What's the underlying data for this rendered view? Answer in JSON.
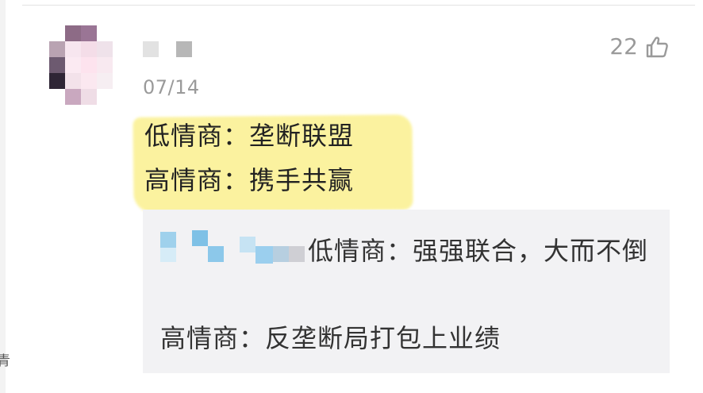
{
  "comment": {
    "date": "07/14",
    "like_count": "22",
    "like_icon": "thumbs-up-icon",
    "lines": [
      "低情商：垄断联盟",
      "高情商：携手共赢"
    ],
    "highlight_color": "#fbf29a"
  },
  "reply": {
    "line1": "低情商：强强联合，大而不倒",
    "line2": "高情商：反垄断局打包上业绩"
  },
  "left_edge_char": "青"
}
